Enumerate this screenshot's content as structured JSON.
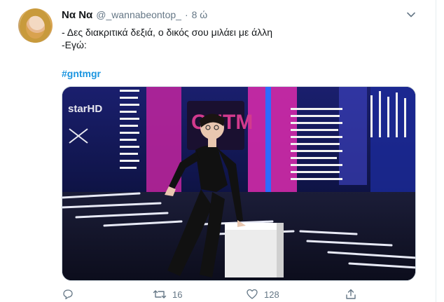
{
  "tweet": {
    "display_name": "Να Να",
    "handle": "@_wannabeontop_",
    "separator": "·",
    "time": "8 ώ",
    "text": "- Δες διακριτικά δεξιά, ο δικός σου μιλάει με άλλη\n-Εγώ:",
    "hashtag": "#gntmgr",
    "media": {
      "logo_text": "GNTM",
      "channel_text": "starHD"
    },
    "actions": {
      "reply_count": "",
      "retweet_count": "16",
      "like_count": "128",
      "share_label": ""
    }
  },
  "icons": [
    "avatar",
    "caret-down-icon",
    "reply-icon",
    "retweet-icon",
    "like-icon",
    "share-icon"
  ],
  "colors": {
    "link": "#1b95e0",
    "secondary_text": "#657786",
    "primary_text": "#14171a"
  }
}
